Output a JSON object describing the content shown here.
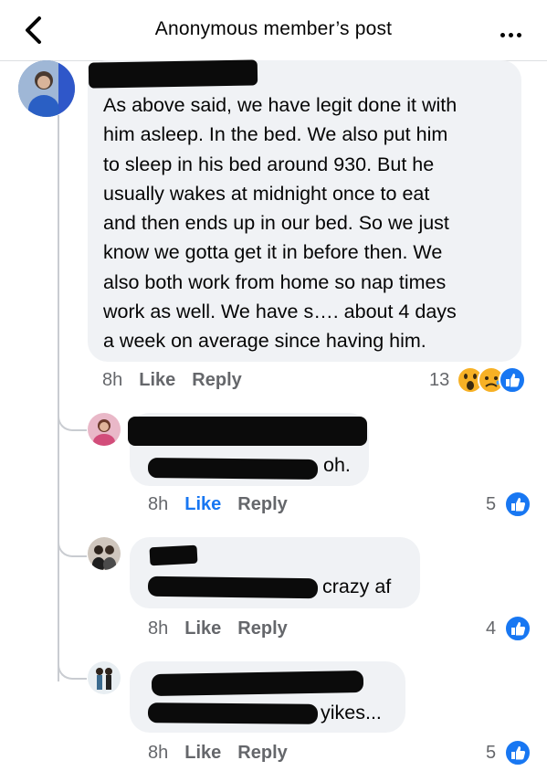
{
  "header": {
    "title": "Anonymous member’s post"
  },
  "main_comment": {
    "lines": [
      "As above said, we have legit done it with",
      "him asleep. In the bed. We also put him",
      "to sleep in his bed around 930. But he",
      "usually wakes at midnight once to eat",
      "and then ends up in our bed. So we just",
      "know we gotta get it in before then. We",
      "also both work from home so nap times",
      "work as well. We have s…. about 4 days",
      "a week on average since having him."
    ],
    "time": "8h",
    "like_label": "Like",
    "reply_label": "Reply",
    "reaction_count": "13",
    "reactions": [
      "wow-icon",
      "sad-icon",
      "like-icon"
    ]
  },
  "replies": [
    {
      "text": "oh.",
      "time": "8h",
      "like_label": "Like",
      "reply_label": "Reply",
      "liked": true,
      "reaction_count": "5",
      "reactions": [
        "like-icon"
      ]
    },
    {
      "text": "crazy af",
      "time": "8h",
      "like_label": "Like",
      "reply_label": "Reply",
      "liked": false,
      "reaction_count": "4",
      "reactions": [
        "like-icon"
      ]
    },
    {
      "text": "yikes...",
      "time": "8h",
      "like_label": "Like",
      "reply_label": "Reply",
      "liked": false,
      "reaction_count": "5",
      "reactions": [
        "like-icon"
      ]
    }
  ],
  "colors": {
    "bubble": "#f0f2f5",
    "accent": "#1877f2",
    "meta": "#65676b"
  }
}
